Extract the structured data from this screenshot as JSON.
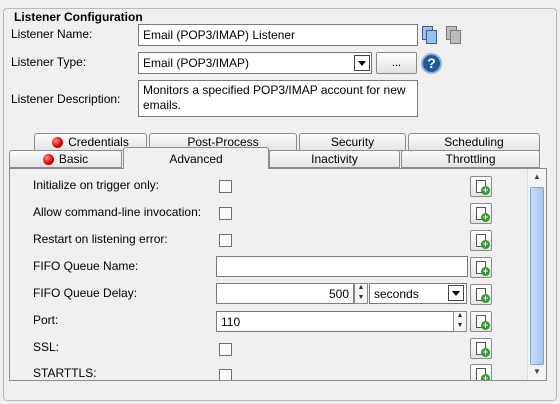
{
  "group": {
    "title": "Listener Configuration"
  },
  "listener_name": {
    "label": "Listener Name:",
    "value": "Email (POP3/IMAP) Listener"
  },
  "listener_type": {
    "label": "Listener Type:",
    "value": "Email (POP3/IMAP)",
    "browse_label": "..."
  },
  "listener_description": {
    "label": "Listener Description:",
    "value": "Monitors a specified POP3/IMAP account for new emails."
  },
  "tabs_back": [
    {
      "label": "Credentials",
      "error": true
    },
    {
      "label": "Post-Process",
      "error": false
    },
    {
      "label": "Security",
      "error": false
    },
    {
      "label": "Scheduling",
      "error": false
    }
  ],
  "tabs_front": [
    {
      "label": "Basic",
      "error": true
    },
    {
      "label": "Advanced",
      "active": true
    },
    {
      "label": "Inactivity"
    },
    {
      "label": "Throttling"
    }
  ],
  "settings": {
    "initialize_on_trigger": {
      "label": "Initialize on trigger only:",
      "checked": false
    },
    "allow_command_line": {
      "label": "Allow command-line invocation:",
      "checked": false
    },
    "restart_on_error": {
      "label": "Restart on listening error:",
      "checked": false
    },
    "fifo_queue_name": {
      "label": "FIFO Queue Name:",
      "value": ""
    },
    "fifo_queue_delay": {
      "label": "FIFO Queue Delay:",
      "value": "500",
      "unit": "seconds"
    },
    "port": {
      "label": "Port:",
      "value": "110"
    },
    "ssl": {
      "label": "SSL:",
      "checked": false
    },
    "starttls": {
      "label": "STARTTLS:",
      "checked": false
    }
  },
  "icons": {
    "help": "?",
    "plus": "+",
    "spin_up": "▲",
    "spin_down": "▼",
    "scroll_up": "▲",
    "scroll_down": "▼"
  }
}
